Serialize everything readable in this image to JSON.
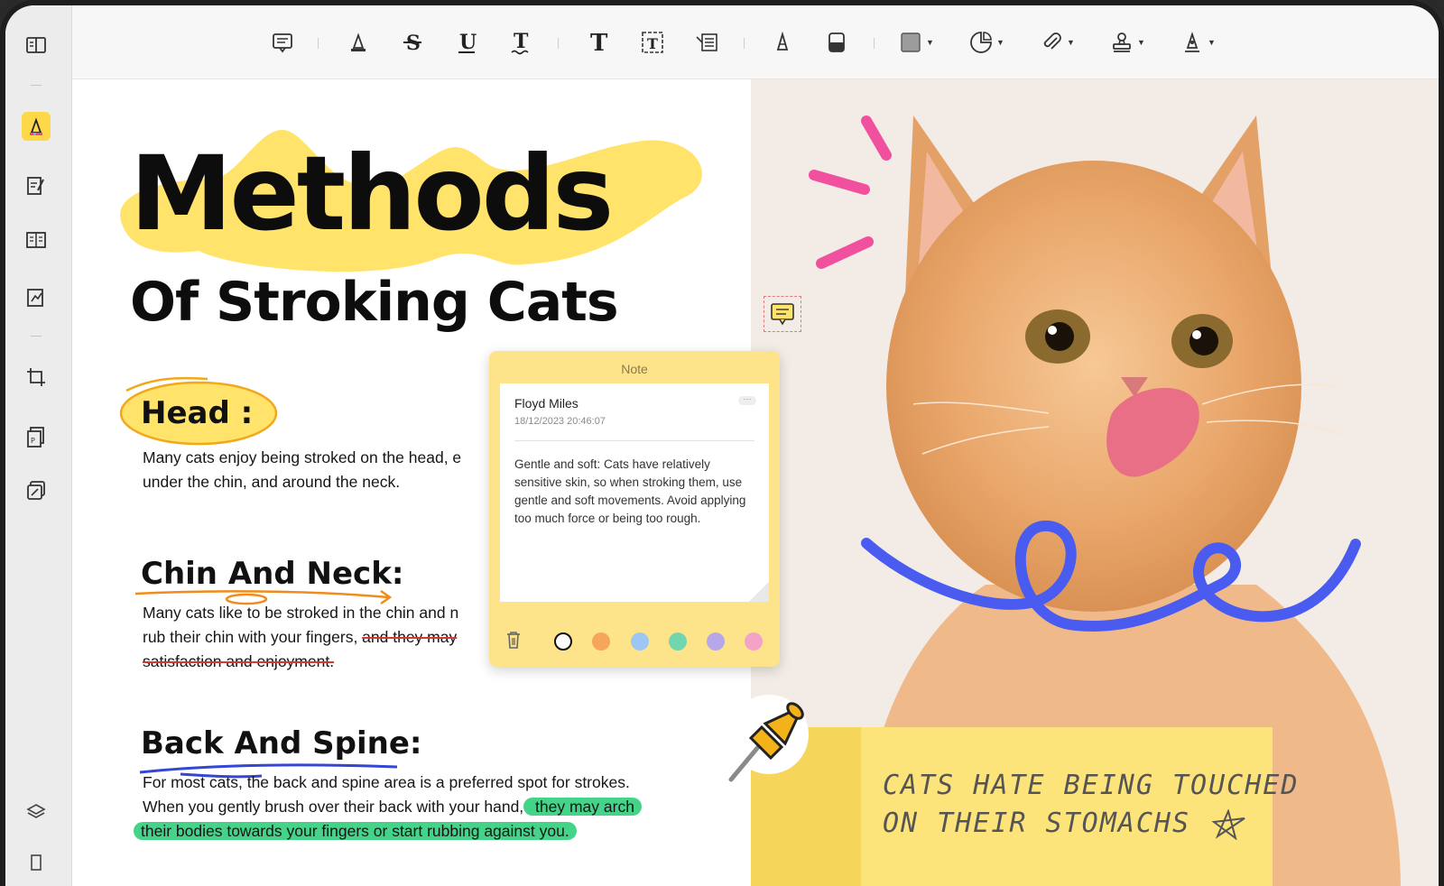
{
  "toolbar": {
    "tools": [
      "comment",
      "highlight",
      "strikethrough",
      "underline",
      "squiggly",
      "text",
      "text-box",
      "text-callout",
      "pencil",
      "eraser",
      "shape",
      "sticker",
      "attachment",
      "stamp",
      "signature"
    ]
  },
  "sidebar": {
    "items": [
      "reader",
      "comment",
      "edit",
      "organize",
      "fill-sign",
      "crop",
      "convert",
      "compress",
      "layers",
      "bookmark"
    ]
  },
  "document": {
    "title": "Methods",
    "subtitle": "Of Stroking Cats",
    "sections": [
      {
        "heading": "Head :",
        "lines": [
          "Many cats enjoy being stroked on the head, e",
          "under the chin, and around the neck."
        ]
      },
      {
        "heading": "Chin And Neck:",
        "line1": "Many cats like to be stroked in the chin and n",
        "line2_plain": "rub their chin with your fingers, ",
        "line2_struck": "and they may",
        "line3_struck": "satisfaction and enjoyment."
      },
      {
        "heading": "Back And Spine:",
        "line1": "For most cats, the back and spine area is a preferred spot for strokes.",
        "line2_plain": "When you gently brush over their back with your hand,",
        "line2_highlight": " they may arch",
        "line3_highlight": "their bodies towards your fingers or start rubbing against you."
      }
    ]
  },
  "note": {
    "header": "Note",
    "author": "Floyd Miles",
    "timestamp": "18/12/2023 20:46:07",
    "more": "···",
    "text": "Gentle and soft: Cats have relatively sensitive skin, so when stroking them, use gentle and soft movements. Avoid applying too much force or being too rough.",
    "colors": [
      "#ffffff",
      "#f5a65b",
      "#9dc6f2",
      "#6fd6b0",
      "#b7a6e8",
      "#f4a3c8"
    ]
  },
  "sticky": {
    "line1": "CATS HATE BEING TOUCHED",
    "line2": "ON THEIR STOMACHS"
  },
  "colors": {
    "highlight_yellow": "#ffe36b",
    "scribble_blue": "#4a5cf0",
    "accent_pink": "#f0509e",
    "highlight_green": "#45d38a"
  }
}
